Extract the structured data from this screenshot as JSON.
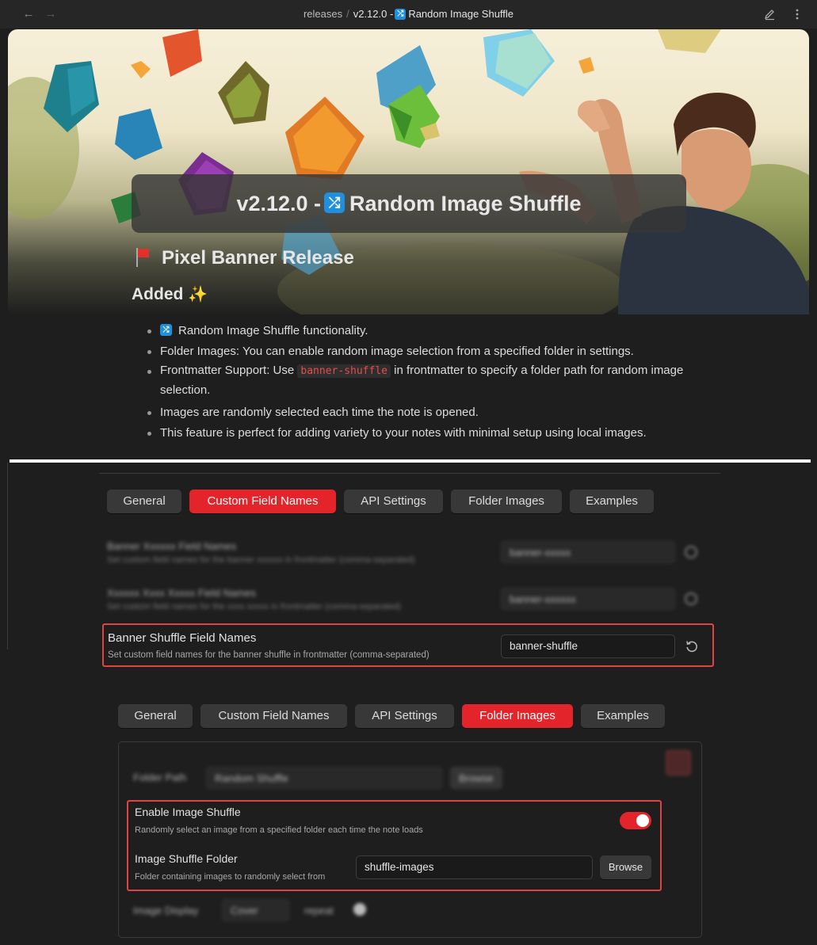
{
  "topbar": {
    "breadcrumb_folder": "releases",
    "breadcrumb_separator": "/",
    "breadcrumb_version": "v2.12.0 -",
    "breadcrumb_emoji": "⤮",
    "breadcrumb_title": "Random Image Shuffle"
  },
  "note": {
    "title_version": "v2.12.0 -",
    "title_emoji": "⤮",
    "title_text": "Random Image Shuffle",
    "heading": "Pixel Banner Release",
    "subheading": "Added",
    "subheading_emoji": "✨",
    "bullets": {
      "b1_emoji": "⤮",
      "b1": "Random Image Shuffle functionality.",
      "b2": "Folder Images: You can enable random image selection from a specified folder in settings.",
      "b3_pre": "Frontmatter Support: Use",
      "b3_code": "banner-shuffle",
      "b3_post": "in frontmatter to specify a folder path for random image selection.",
      "b4": "Images are randomly selected each time the note is opened.",
      "b5": "This feature is perfect for adding variety to your notes with minimal setup using local images."
    }
  },
  "settings1": {
    "tabs": [
      "General",
      "Custom Field Names",
      "API Settings",
      "Folder Images",
      "Examples"
    ],
    "active_tab": "Custom Field Names",
    "blurred_rows": [
      {
        "name": "Banner Xxxxxx Field Names",
        "desc": "Set custom field names for the banner xxxxxx in frontmatter (comma-separated)",
        "value": "banner-xxxxx"
      },
      {
        "name": "Xxxxxx Xxxx Xxxxx Field Names",
        "desc": "Set custom field names for the xxxx xxxxx in frontmatter (comma-separated)",
        "value": "banner-xxxxxx"
      }
    ],
    "shuffle_field": {
      "name": "Banner Shuffle Field Names",
      "desc": "Set custom field names for the banner shuffle in frontmatter (comma-separated)",
      "value": "banner-shuffle"
    }
  },
  "settings2": {
    "tabs": [
      "General",
      "Custom Field Names",
      "API Settings",
      "Folder Images",
      "Examples"
    ],
    "active_tab": "Folder Images",
    "blurred_top": {
      "label": "Folder Path",
      "value": "Random Shuffle",
      "button": "Browse"
    },
    "enable_shuffle": {
      "name": "Enable Image Shuffle",
      "desc": "Randomly select an image from a specified folder each time the note loads",
      "enabled": true
    },
    "shuffle_folder": {
      "name": "Image Shuffle Folder",
      "desc": "Folder containing images to randomly select from",
      "value": "shuffle-images",
      "button": "Browse"
    },
    "blurred_bottom": {
      "label": "Image Display",
      "value": "Cover",
      "label2": "repeat"
    }
  },
  "colors": {
    "accent": "#e3242b",
    "highlight_box": "#e04343",
    "code_text": "#e94b4b",
    "background": "#1e1e1e"
  }
}
